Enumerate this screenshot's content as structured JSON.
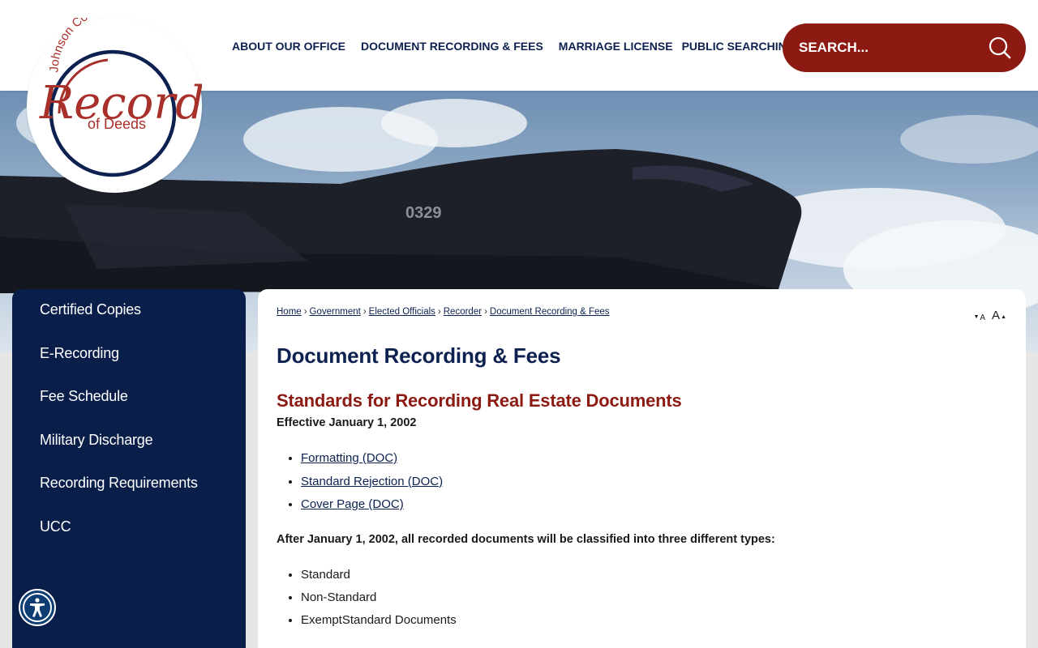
{
  "logo": {
    "arc_text": "Johnson County MO",
    "main_text": "Recorder",
    "sub_text": "of Deeds"
  },
  "nav": {
    "items": [
      {
        "label": "ABOUT OUR OFFICE"
      },
      {
        "label": "DOCUMENT RECORDING & FEES"
      },
      {
        "label": "MARRIAGE LICENSE"
      },
      {
        "label": "PUBLIC SEARCHING"
      }
    ]
  },
  "search": {
    "placeholder": "SEARCH..."
  },
  "hero": {
    "aircraft_marking": "0329"
  },
  "sidebar": {
    "items": [
      {
        "label": "Certified Copies"
      },
      {
        "label": "E-Recording"
      },
      {
        "label": "Fee Schedule"
      },
      {
        "label": "Military Discharge"
      },
      {
        "label": "Recording Requirements"
      },
      {
        "label": "UCC"
      }
    ]
  },
  "breadcrumb": {
    "items": [
      {
        "label": "Home"
      },
      {
        "label": "Government"
      },
      {
        "label": "Elected Officials"
      },
      {
        "label": "Recorder"
      },
      {
        "label": "Document Recording & Fees"
      }
    ],
    "separator": "›"
  },
  "font_controls": {
    "small": "A",
    "large": "A"
  },
  "content": {
    "page_title": "Document Recording & Fees",
    "section_title": "Standards for Recording Real Estate Documents",
    "effective": "Effective January 1, 2002",
    "links": [
      {
        "label": "Formatting (DOC)"
      },
      {
        "label": "Standard Rejection (DOC)"
      },
      {
        "label": "Cover Page (DOC)"
      }
    ],
    "paragraph": "After January 1, 2002, all recorded documents will be classified into three different types:",
    "types": [
      {
        "label": "Standard"
      },
      {
        "label": "Non-Standard"
      },
      {
        "label": "ExemptStandard Documents"
      }
    ]
  },
  "colors": {
    "navy": "#0a1e4a",
    "brand_red": "#8c1a12",
    "white": "#ffffff"
  }
}
